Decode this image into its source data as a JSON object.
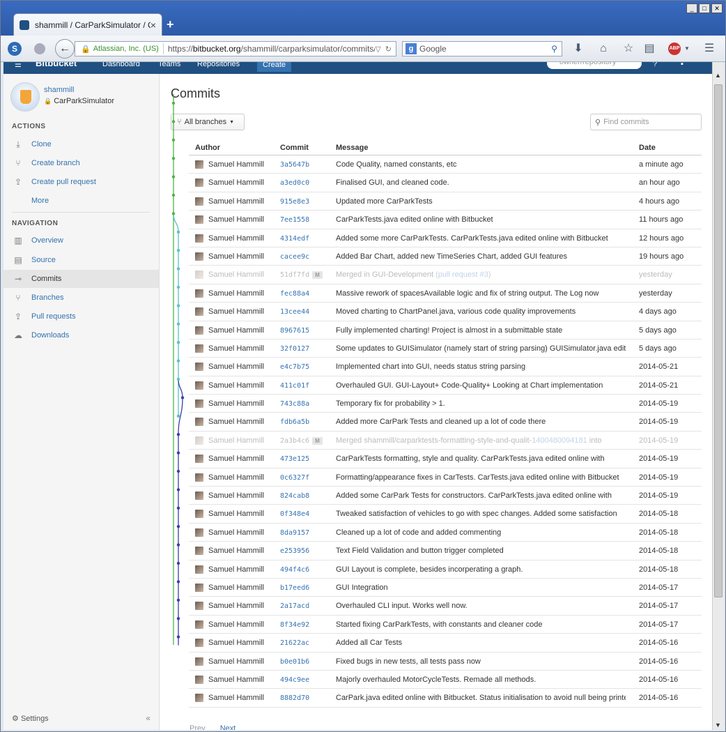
{
  "browser": {
    "tab_title": "shammill / CarParkSimulator / Co...",
    "tab_close": "×",
    "new_tab": "+",
    "url_org": "Atlassian, Inc. (US)",
    "url_prefix": "https://",
    "url_domain": "bitbucket.org",
    "url_path": "/shammill/carparksimulator/commits/all",
    "search_placeholder": "Google",
    "search_engine": "g",
    "window_buttons": [
      "_",
      "□",
      "✕"
    ],
    "abp": "ABP"
  },
  "bitbucket_header": {
    "logo": "Bitbucket",
    "dashboard": "Dashboard",
    "teams": "Teams",
    "repositories": "Repositories",
    "create": "Create",
    "search_placeholder": "owner/repository"
  },
  "sidebar": {
    "owner": "shammill",
    "repo": "CarParkSimulator",
    "actions_title": "ACTIONS",
    "actions": [
      {
        "label": "Clone",
        "icon": "download-icon"
      },
      {
        "label": "Create branch",
        "icon": "branch-icon"
      },
      {
        "label": "Create pull request",
        "icon": "pull-request-icon"
      },
      {
        "label": "More",
        "icon": ""
      }
    ],
    "navigation_title": "NAVIGATION",
    "navigation": [
      {
        "label": "Overview",
        "icon": "chart-icon"
      },
      {
        "label": "Source",
        "icon": "file-icon"
      },
      {
        "label": "Commits",
        "icon": "commit-icon"
      },
      {
        "label": "Branches",
        "icon": "branch-icon"
      },
      {
        "label": "Pull requests",
        "icon": "pull-request-icon"
      },
      {
        "label": "Downloads",
        "icon": "cloud-icon"
      }
    ],
    "settings": "Settings",
    "collapse": "«"
  },
  "main": {
    "title": "Commits",
    "branch_button": "All branches",
    "find_placeholder": "Find commits",
    "columns": {
      "author": "Author",
      "commit": "Commit",
      "message": "Message",
      "date": "Date"
    },
    "rows": [
      {
        "author": "Samuel Hammill",
        "hash": "3a5647b",
        "message": "Code Quality, named constants, etc",
        "date": "a minute ago"
      },
      {
        "author": "Samuel Hammill",
        "hash": "a3ed0c0",
        "message": "Finalised GUI, and cleaned code.",
        "date": "an hour ago"
      },
      {
        "author": "Samuel Hammill",
        "hash": "915e8e3",
        "message": "Updated more CarParkTests",
        "date": "4 hours ago"
      },
      {
        "author": "Samuel Hammill",
        "hash": "7ee1558",
        "message": "CarParkTests.java edited online with Bitbucket",
        "date": "11 hours ago"
      },
      {
        "author": "Samuel Hammill",
        "hash": "4314edf",
        "message": "Added some more CarParkTests. CarParkTests.java edited online with Bitbucket",
        "date": "12 hours ago"
      },
      {
        "author": "Samuel Hammill",
        "hash": "cacee9c",
        "message": "Added Bar Chart, added new TimeSeries Chart, added GUI features",
        "date": "19 hours ago"
      },
      {
        "author": "Samuel Hammill",
        "hash": "51df7fd",
        "message": "Merged in GUI-Development ",
        "link": "(pull request #3)",
        "date": "yesterday",
        "merge": true
      },
      {
        "author": "Samuel Hammill",
        "hash": "fec88a4",
        "message": "Massive rework of spacesAvailable logic and fix of string output. The Log now",
        "date": "yesterday"
      },
      {
        "author": "Samuel Hammill",
        "hash": "13cee44",
        "message": "Moved charting to ChartPanel.java, various code quality improvements",
        "date": "4 days ago"
      },
      {
        "author": "Samuel Hammill",
        "hash": "8967615",
        "message": "Fully implemented charting! Project is almost in a submittable state",
        "date": "5 days ago"
      },
      {
        "author": "Samuel Hammill",
        "hash": "32f0127",
        "message": "Some updates to GUISimulator (namely start of string parsing) GUISimulator.java edited",
        "date": "5 days ago"
      },
      {
        "author": "Samuel Hammill",
        "hash": "e4c7b75",
        "message": "Implemented chart into GUI, needs status string parsing",
        "date": "2014-05-21"
      },
      {
        "author": "Samuel Hammill",
        "hash": "411c01f",
        "message": "Overhauled GUI. GUI-Layout+ Code-Quality+ Looking at Chart implementation",
        "date": "2014-05-21"
      },
      {
        "author": "Samuel Hammill",
        "hash": "743c88a",
        "message": "Temporary fix for probability > 1.",
        "date": "2014-05-19"
      },
      {
        "author": "Samuel Hammill",
        "hash": "fdb6a5b",
        "message": "Added more CarPark Tests and cleaned up a lot of code there",
        "date": "2014-05-19"
      },
      {
        "author": "Samuel Hammill",
        "hash": "2a3b4c6",
        "message": "Merged shammill/carparktests-formatting-style-and-qualit-",
        "link": "1400480094181",
        "message_after": " into",
        "date": "2014-05-19",
        "merge": true
      },
      {
        "author": "Samuel Hammill",
        "hash": "473e125",
        "message": "CarParkTests formatting, style and quality. CarParkTests.java edited online with",
        "date": "2014-05-19"
      },
      {
        "author": "Samuel Hammill",
        "hash": "0c6327f",
        "message": "Formatting/appearance fixes in CarTests. CarTests.java edited online with Bitbucket",
        "date": "2014-05-19"
      },
      {
        "author": "Samuel Hammill",
        "hash": "824cab8",
        "message": "Added some CarPark Tests for constructors. CarParkTests.java edited online with",
        "date": "2014-05-19"
      },
      {
        "author": "Samuel Hammill",
        "hash": "0f348e4",
        "message": "Tweaked satisfaction of vehicles to go with spec changes. Added some satisfaction",
        "date": "2014-05-18"
      },
      {
        "author": "Samuel Hammill",
        "hash": "8da9157",
        "message": "Cleaned up a lot of code and added commenting",
        "date": "2014-05-18"
      },
      {
        "author": "Samuel Hammill",
        "hash": "e253956",
        "message": "Text Field Validation and button trigger completed",
        "date": "2014-05-18"
      },
      {
        "author": "Samuel Hammill",
        "hash": "494f4c6",
        "message": "GUI Layout is complete, besides incorperating a graph.",
        "date": "2014-05-18"
      },
      {
        "author": "Samuel Hammill",
        "hash": "b17eed6",
        "message": "GUI Integration",
        "date": "2014-05-17"
      },
      {
        "author": "Samuel Hammill",
        "hash": "2a17acd",
        "message": "Overhauled CLI input. Works well now.",
        "date": "2014-05-17"
      },
      {
        "author": "Samuel Hammill",
        "hash": "8f34e92",
        "message": "Started fixing CarParkTests, with constants and cleaner code",
        "date": "2014-05-17"
      },
      {
        "author": "Samuel Hammill",
        "hash": "21622ac",
        "message": "Added all Car Tests",
        "date": "2014-05-16"
      },
      {
        "author": "Samuel Hammill",
        "hash": "b0e01b6",
        "message": "Fixed bugs in new tests, all tests pass now",
        "date": "2014-05-16"
      },
      {
        "author": "Samuel Hammill",
        "hash": "494c9ee",
        "message": "Majorly overhauled MotorCycleTests. Remade all methods.",
        "date": "2014-05-16"
      },
      {
        "author": "Samuel Hammill",
        "hash": "8882d70",
        "message": "CarPark.java edited online with Bitbucket. Status initialisation to avoid null being printed",
        "date": "2014-05-16"
      }
    ],
    "merge_tag": "M",
    "prev": "Prev",
    "next": "Next"
  },
  "colors": {
    "brand": "#205081",
    "link": "#3572b0",
    "graph_green": "#4bb543",
    "graph_teal": "#5bc0c8",
    "graph_blue": "#3b3fa8"
  }
}
